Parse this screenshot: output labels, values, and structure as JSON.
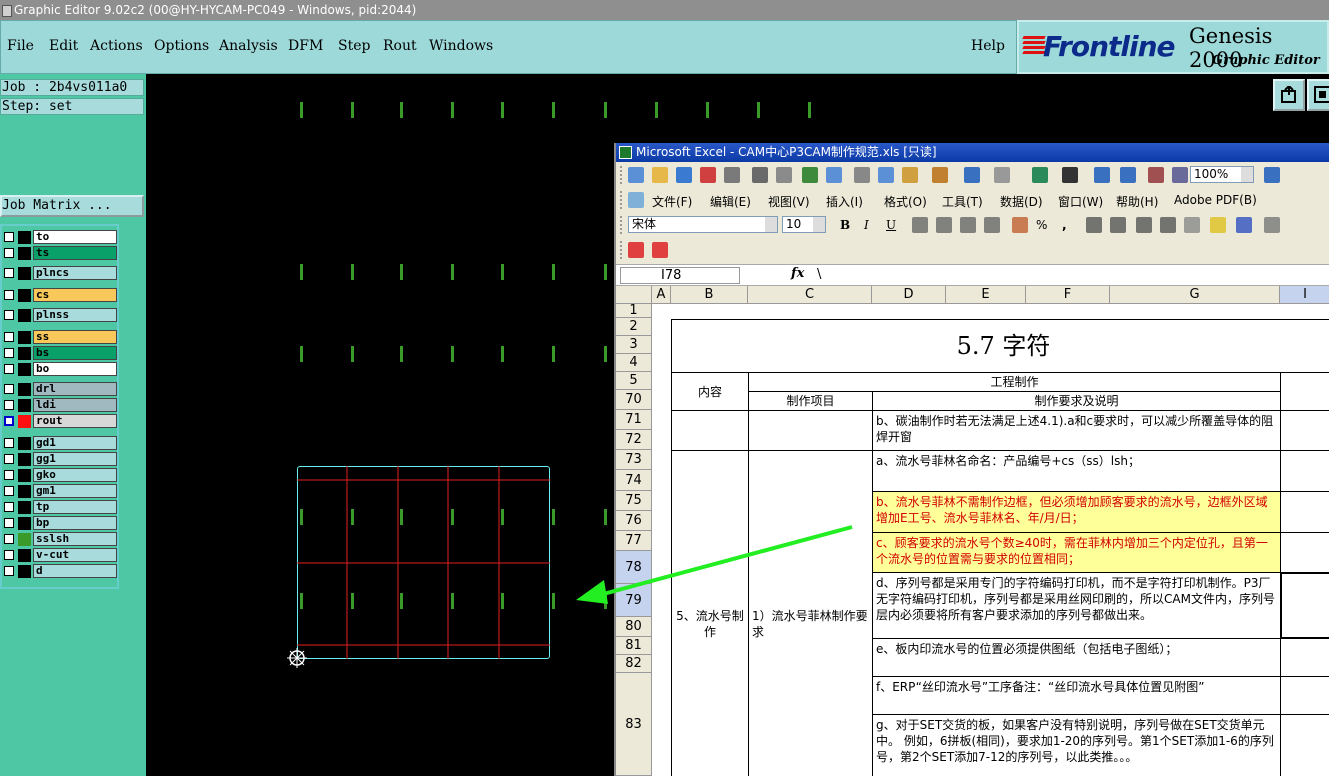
{
  "window": {
    "title": "Graphic Editor 9.02c2 (00@HY-HYCAM-PC049 - Windows, pid:2044)"
  },
  "menu": {
    "file": "File",
    "edit": "Edit",
    "actions": "Actions",
    "options": "Options",
    "analysis": "Analysis",
    "dfm": "DFM",
    "step": "Step",
    "rout": "Rout",
    "windows": "Windows",
    "help": "Help"
  },
  "brand": {
    "logo": "Frontline",
    "product": "Genesis 2000",
    "subtitle": "Graphic Editor"
  },
  "job": {
    "job_label": "Job : 2b4vs011a0",
    "step_label": "Step: set",
    "matrix_button": "Job Matrix ..."
  },
  "layers": [
    {
      "name": "to",
      "color": "#ffffff"
    },
    {
      "name": "ts",
      "color": "#0aa06a"
    },
    {
      "name": "plncs",
      "color": "#a8dcdc"
    },
    {
      "name": "cs",
      "color": "#f8c85a"
    },
    {
      "name": "plnss",
      "color": "#a8dcdc"
    },
    {
      "name": "ss",
      "color": "#f8c85a"
    },
    {
      "name": "bs",
      "color": "#0aa06a"
    },
    {
      "name": "bo",
      "color": "#ffffff"
    },
    {
      "name": "drl",
      "color": "#a0b8c0"
    },
    {
      "name": "ldi",
      "color": "#a0b8c0"
    },
    {
      "name": "rout",
      "color": "#d8d8d8"
    },
    {
      "name": "gd1",
      "color": "#a8dcdc"
    },
    {
      "name": "gg1",
      "color": "#a8dcdc"
    },
    {
      "name": "gko",
      "color": "#a8dcdc"
    },
    {
      "name": "gm1",
      "color": "#a8dcdc"
    },
    {
      "name": "tp",
      "color": "#a8dcdc"
    },
    {
      "name": "bp",
      "color": "#a8dcdc"
    },
    {
      "name": "sslsh",
      "color": "#a8dcdc"
    },
    {
      "name": "v-cut",
      "color": "#a8dcdc"
    },
    {
      "name": "d",
      "color": "#a8dcdc"
    }
  ],
  "excel": {
    "title": "Microsoft Excel - CAM中心P3CAM制作规范.xls [只读]",
    "menu": {
      "file": "文件(F)",
      "edit": "编辑(E)",
      "view": "视图(V)",
      "insert": "插入(I)",
      "format": "格式(O)",
      "tools": "工具(T)",
      "data": "数据(D)",
      "window": "窗口(W)",
      "help": "帮助(H)",
      "pdf": "Adobe PDF(B)"
    },
    "zoom": "100%",
    "font": "宋体",
    "font_size": "10",
    "bold": "B",
    "italic": "I",
    "underline": "U",
    "percent": "%",
    "comma": ",",
    "namebox": "I78",
    "fx": "fx",
    "formula": "\\",
    "columns": [
      "A",
      "B",
      "C",
      "D",
      "E",
      "F",
      "G",
      "I"
    ],
    "rows": [
      "1",
      "2",
      "3",
      "4",
      "5",
      "70",
      "71",
      "72",
      "73",
      "74",
      "75",
      "76",
      "77",
      "78",
      "79",
      "80",
      "81",
      "82",
      "83"
    ],
    "sheet_title": "5.7 字符",
    "hdr_content": "内容",
    "hdr_engineering": "工程制作",
    "hdr_item": "制作项目",
    "hdr_req": "制作要求及说明",
    "section": "5、流水号制作",
    "item": "1）流水号菲林制作要求",
    "r70": "b、碳油制作时若无法满足上述4.1).a和c要求时，可以减少所覆盖导体的阻焊开窗",
    "r72": "a、流水号菲林名命名：产品编号+cs（ss）lsh；",
    "r74": "b、流水号菲林不需制作边框，但必须增加顾客要求的流水号，边框外区域增加E工号、流水号菲林名、年/月/日；",
    "r76": "c、顾客要求的流水号个数≥40时，需在菲林内增加三个内定位孔，且第一个流水号的位置需与要求的位置相同；",
    "r78": "d、序列号都是采用专门的字符编码打印机，而不是字符打印机制作。P3厂无字符编码打印机，序列号都是采用丝网印刷的，所以CAM文件内，序列号层内必须要将所有客户要求添加的序列号都做出来。",
    "r80": "e、板内印流水号的位置必须提供图纸（包括电子图纸）；",
    "r81": "f、ERP“丝印流水号”工序备注：“丝印流水号具体位置见附图”",
    "r83": "g、对于SET交货的板，如果客户没有特别说明，序列号做在SET交货单元中。 例如，6拼板(相同)，要求加1-20的序列号。第1个SET添加1-6的序列号，第2个SET添加7-12的序列号，以此类推。。。"
  }
}
